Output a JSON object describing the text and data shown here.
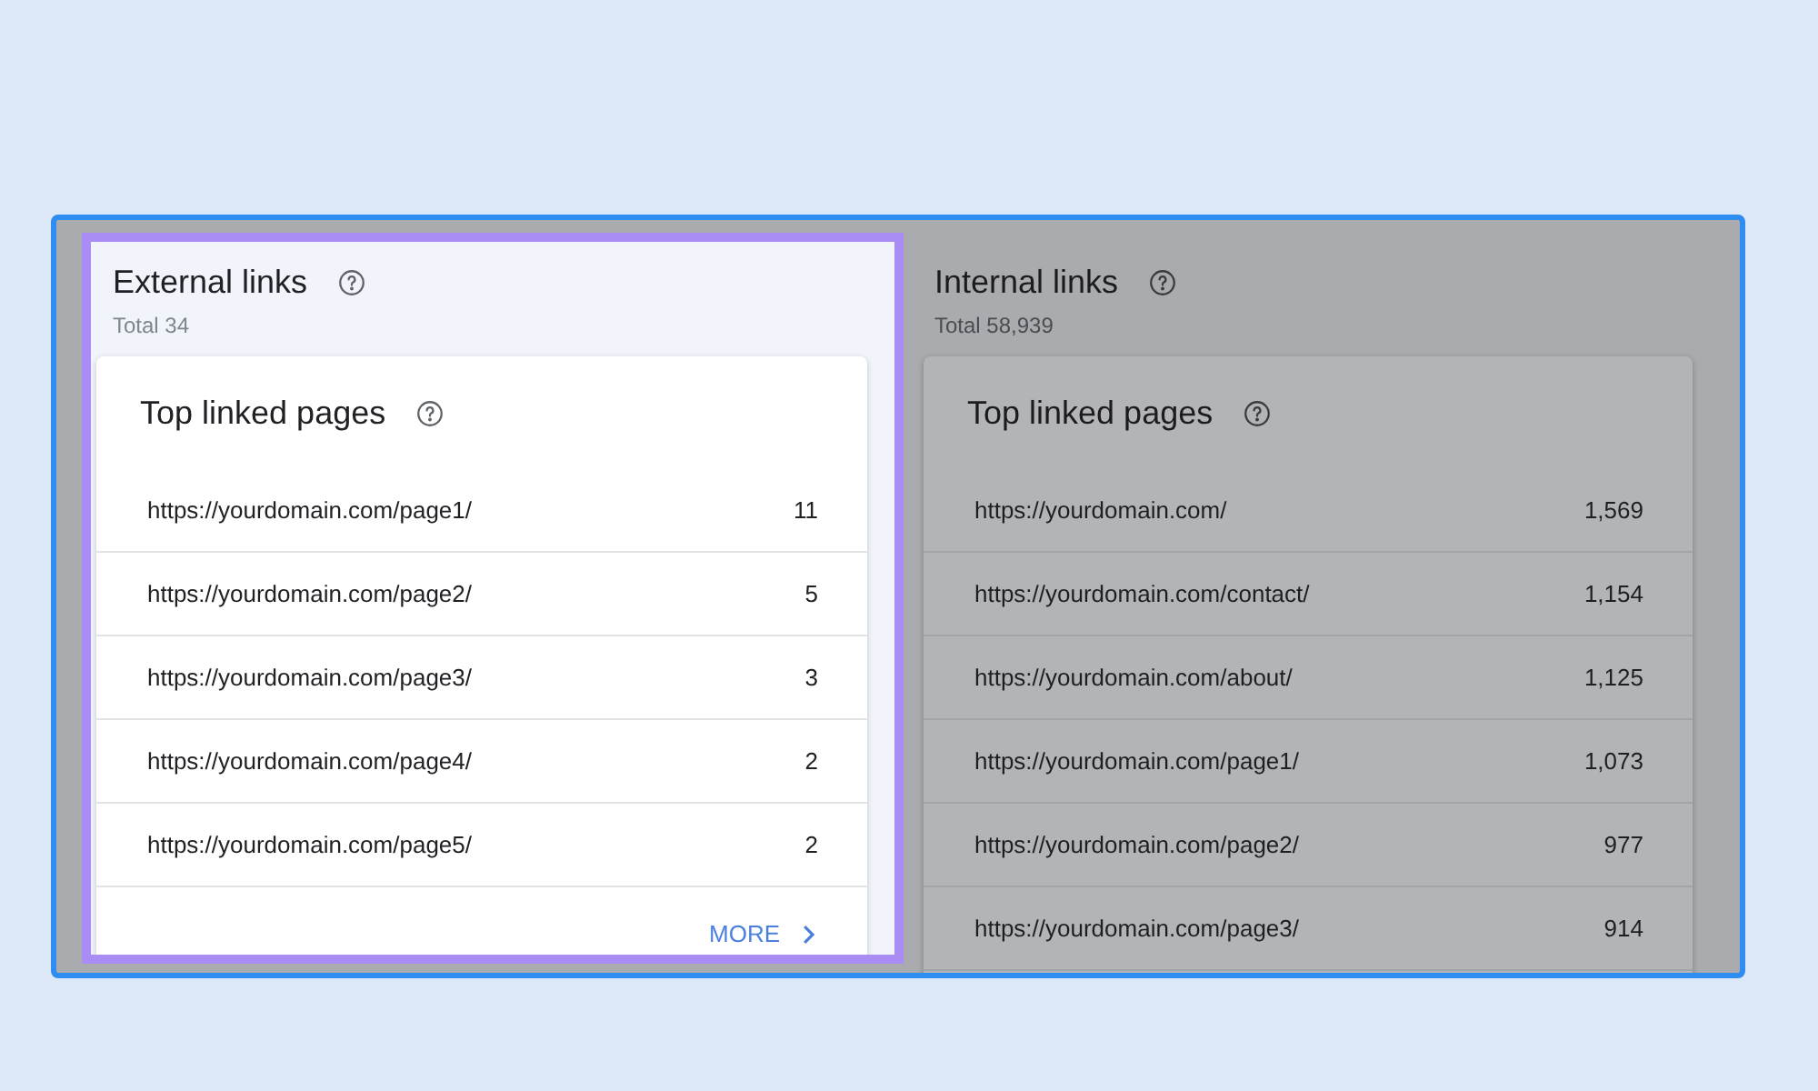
{
  "panels": [
    {
      "title": "External links",
      "total": "Total 34",
      "highlighted": true,
      "card": {
        "title": "Top linked pages",
        "rows": [
          {
            "url": "https://yourdomain.com/page1/",
            "count": "11"
          },
          {
            "url": "https://yourdomain.com/page2/",
            "count": "5"
          },
          {
            "url": "https://yourdomain.com/page3/",
            "count": "3"
          },
          {
            "url": "https://yourdomain.com/page4/",
            "count": "2"
          },
          {
            "url": "https://yourdomain.com/page5/",
            "count": "2"
          }
        ],
        "more": "MORE"
      }
    },
    {
      "title": "Internal links",
      "total": "Total 58,939",
      "highlighted": false,
      "card": {
        "title": "Top linked pages",
        "rows": [
          {
            "url": "https://yourdomain.com/",
            "count": "1,569"
          },
          {
            "url": "https://yourdomain.com/contact/",
            "count": "1,154"
          },
          {
            "url": "https://yourdomain.com/about/",
            "count": "1,125"
          },
          {
            "url": "https://yourdomain.com/page1/",
            "count": "1,073"
          },
          {
            "url": "https://yourdomain.com/page2/",
            "count": "977"
          },
          {
            "url": "https://yourdomain.com/page3/",
            "count": "914"
          }
        ]
      }
    }
  ]
}
